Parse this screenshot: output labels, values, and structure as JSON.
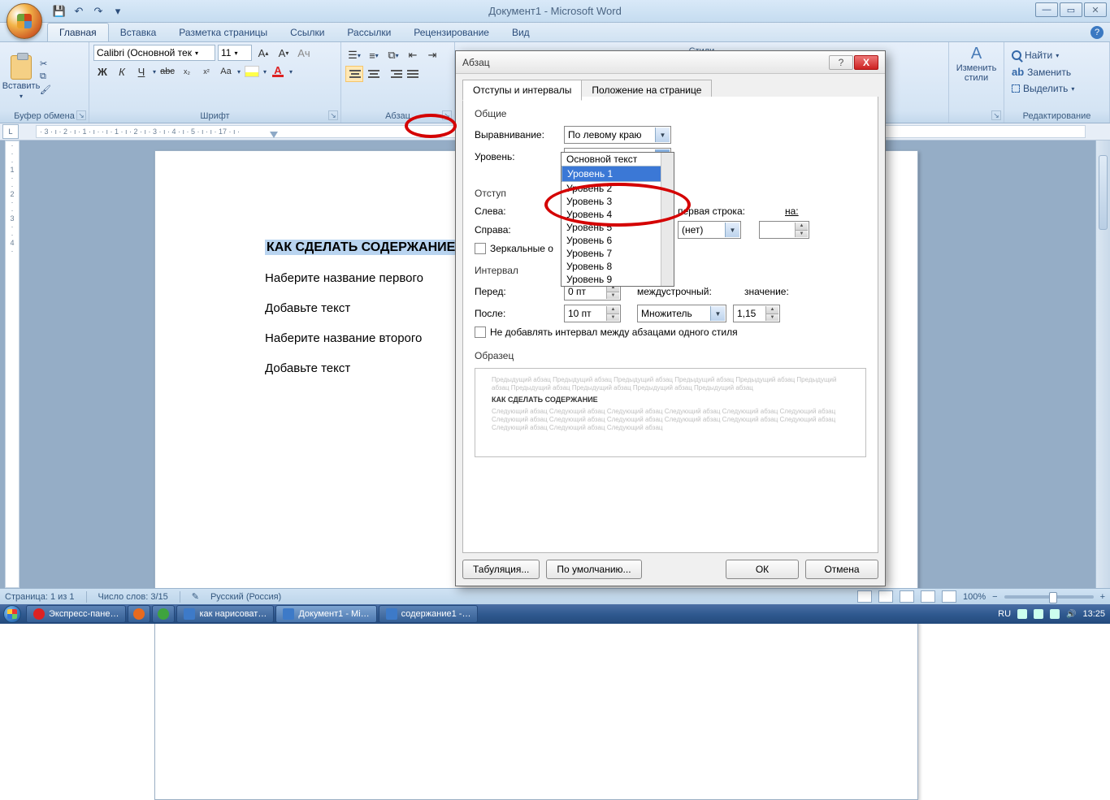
{
  "app": {
    "title": "Документ1 - Microsoft Word"
  },
  "tabs": {
    "home": "Главная",
    "insert": "Вставка",
    "layout": "Разметка страницы",
    "references": "Ссылки",
    "mailings": "Рассылки",
    "review": "Рецензирование",
    "view": "Вид"
  },
  "ribbon": {
    "clipboard": {
      "paste": "Вставить",
      "label": "Буфер обмена"
    },
    "font": {
      "name": "Calibri (Основной тек",
      "size": "11",
      "label": "Шрифт",
      "A": "A",
      "bold": "Ж",
      "italic": "К",
      "underline": "Ч",
      "strike": "abc",
      "subscript": "x₂",
      "superscript": "x²",
      "case": "Aa",
      "clear": "A"
    },
    "paragraph": {
      "label": "Абзац"
    },
    "styles": {
      "change": "Изменить",
      "change2": "стили",
      "label": "Стили"
    },
    "editing": {
      "find": "Найти",
      "replace": "Заменить",
      "select": "Выделить",
      "label": "Редактирование"
    }
  },
  "ruler_text": "· 3 · ı · 2 · ı · 1 · ı ·     · ı · 1 · ı · 2 · ı · 3 · ı · 4 · ı · 5 · ı                                                                                           · ı · 17 · ı ·",
  "doc": {
    "heading": "КАК СДЕЛАТЬ СОДЕРЖАНИЕ",
    "line2": "Наберите название первого",
    "line3": "Добавьте текст",
    "line4": "Наберите название второго",
    "line5": "Добавьте текст"
  },
  "dialog": {
    "title": "Абзац",
    "tab1": "Отступы и интервалы",
    "tab2": "Положение на странице",
    "general": "Общие",
    "alignment_lbl": "Выравнивание:",
    "alignment_val": "По левому краю",
    "level_lbl": "Уровень:",
    "level_val": "Уровень 1",
    "level_options": [
      "Основной текст",
      "Уровень 1",
      "Уровень 2",
      "Уровень 3",
      "Уровень 4",
      "Уровень 5",
      "Уровень 6",
      "Уровень 7",
      "Уровень 8",
      "Уровень 9"
    ],
    "indent": "Отступ",
    "left_lbl": "Слева:",
    "right_lbl": "Справа:",
    "firstline_lbl": "первая строка:",
    "firstline_val": "(нет)",
    "on_lbl": "на:",
    "mirror": "Зеркальные о",
    "spacing": "Интервал",
    "before_lbl": "Перед:",
    "before_val": "0 пт",
    "after_lbl": "После:",
    "after_val": "10 пт",
    "linespacing_lbl": "междустрочный:",
    "linespacing_val": "Множитель",
    "value_lbl": "значение:",
    "value_val": "1,15",
    "noadd": "Не добавлять интервал между абзацами одного стиля",
    "preview": "Образец",
    "prev_text": "Предыдущий абзац Предыдущий абзац Предыдущий абзац Предыдущий абзац Предыдущий абзац Предыдущий абзац Предыдущий абзац Предыдущий абзац Предыдущий абзац Предыдущий абзац",
    "prev_bold": "КАК СДЕЛАТЬ СОДЕРЖАНИЕ",
    "prev_next": "Следующий абзац Следующий абзац Следующий абзац Следующий абзац Следующий абзац Следующий абзац Следующий абзац Следующий абзац Следующий абзац Следующий абзац Следующий абзац Следующий абзац Следующий абзац Следующий абзац Следующий абзац",
    "tabs_btn": "Табуляция...",
    "default_btn": "По умолчанию...",
    "ok_btn": "ОК",
    "cancel_btn": "Отмена"
  },
  "statusbar": {
    "page": "Страница: 1 из 1",
    "words": "Число слов: 3/15",
    "lang": "Русский (Россия)",
    "zoom": "100%"
  },
  "taskbar": {
    "items": [
      "Экспресс-пане…",
      "как нарисоват…",
      "Документ1 - Mi…",
      "содержание1 -…"
    ],
    "lang": "RU",
    "time": "13:25"
  }
}
